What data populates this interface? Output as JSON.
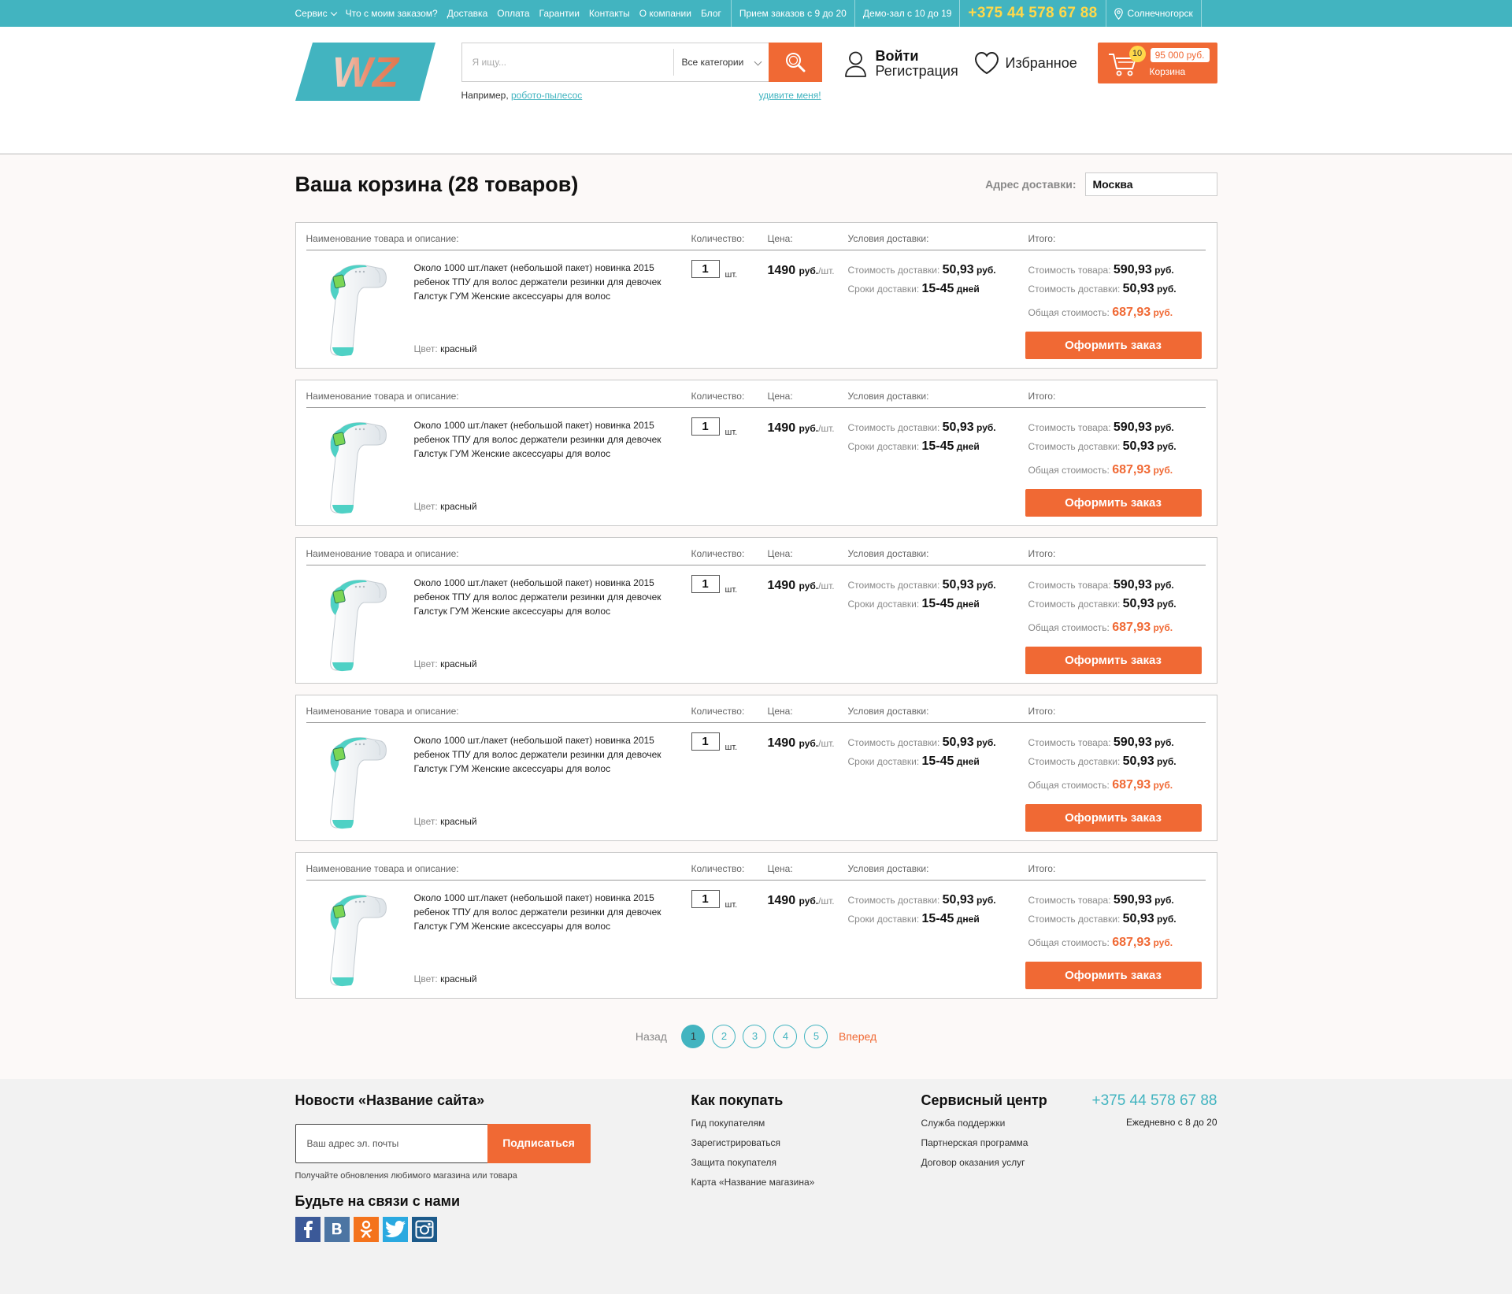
{
  "topbar": {
    "nav": [
      "Сервис",
      "Что с моим заказом?",
      "Доставка",
      "Оплата",
      "Гарантии",
      "Контакты",
      "О компании",
      "Блог"
    ],
    "orders_hours": "Прием заказов с 9 до 20",
    "demo_hours": "Демо-зал с 10 до 19",
    "phone": "+375 44 578 67 88",
    "city": "Солнечногорск"
  },
  "header": {
    "logo_text": "WZ",
    "search_placeholder": "Я ищу...",
    "category": "Все категории",
    "hint_prefix": "Например,",
    "hint_link": "робото-пылесос",
    "surprise": "удивите меня!",
    "login": "Войти",
    "register": "Регистрация",
    "favorites": "Избранное",
    "cart_count": "10",
    "cart_sum": "95 000 руб.",
    "cart_label": "Корзина"
  },
  "page": {
    "title": "Ваша корзина (28 товаров)",
    "address_label": "Адрес доставки:",
    "address_value": "Москва"
  },
  "columns": {
    "name": "Наименование товара и описание:",
    "qty": "Количество:",
    "price": "Цена:",
    "delivery": "Условия доставки:",
    "total": "Итого:"
  },
  "cart_items": [
    {
      "desc": "Около 1000 шт./пакет (небольшой пакет) новинка 2015 ребенок ТПУ для волос держатели резинки для девочек Галстук ГУМ Женские аксессуары для волос",
      "color_label": "Цвет:",
      "color": "красный",
      "qty": "1",
      "unit": "шт.",
      "price": "1490",
      "price_cur": "руб.",
      "price_per": "/шт.",
      "delivery_cost_label": "Стоимость доставки:",
      "delivery_cost": "50,93",
      "delivery_time_label": "Сроки доставки:",
      "delivery_time": "15-45",
      "delivery_time_unit": "дней",
      "goods_cost_label": "Стоимость товара:",
      "goods_cost": "590,93",
      "ship_cost_label": "Стоимость доставки:",
      "ship_cost": "50,93",
      "total_label": "Общая стоимость:",
      "total": "687,93",
      "cur": "руб.",
      "order_btn": "Оформить заказ"
    },
    {
      "desc": "Около 1000 шт./пакет (небольшой пакет) новинка 2015 ребенок ТПУ для волос держатели резинки для девочек Галстук ГУМ Женские аксессуары для волос",
      "color_label": "Цвет:",
      "color": "красный",
      "qty": "1",
      "unit": "шт.",
      "price": "1490",
      "price_cur": "руб.",
      "price_per": "/шт.",
      "delivery_cost_label": "Стоимость доставки:",
      "delivery_cost": "50,93",
      "delivery_time_label": "Сроки доставки:",
      "delivery_time": "15-45",
      "delivery_time_unit": "дней",
      "goods_cost_label": "Стоимость товара:",
      "goods_cost": "590,93",
      "ship_cost_label": "Стоимость доставки:",
      "ship_cost": "50,93",
      "total_label": "Общая стоимость:",
      "total": "687,93",
      "cur": "руб.",
      "order_btn": "Оформить заказ"
    },
    {
      "desc": "Около 1000 шт./пакет (небольшой пакет) новинка 2015 ребенок ТПУ для волос держатели резинки для девочек Галстук ГУМ Женские аксессуары для волос",
      "color_label": "Цвет:",
      "color": "красный",
      "qty": "1",
      "unit": "шт.",
      "price": "1490",
      "price_cur": "руб.",
      "price_per": "/шт.",
      "delivery_cost_label": "Стоимость доставки:",
      "delivery_cost": "50,93",
      "delivery_time_label": "Сроки доставки:",
      "delivery_time": "15-45",
      "delivery_time_unit": "дней",
      "goods_cost_label": "Стоимость товара:",
      "goods_cost": "590,93",
      "ship_cost_label": "Стоимость доставки:",
      "ship_cost": "50,93",
      "total_label": "Общая стоимость:",
      "total": "687,93",
      "cur": "руб.",
      "order_btn": "Оформить заказ"
    },
    {
      "desc": "Около 1000 шт./пакет (небольшой пакет) новинка 2015 ребенок ТПУ для волос держатели резинки для девочек Галстук ГУМ Женские аксессуары для волос",
      "color_label": "Цвет:",
      "color": "красный",
      "qty": "1",
      "unit": "шт.",
      "price": "1490",
      "price_cur": "руб.",
      "price_per": "/шт.",
      "delivery_cost_label": "Стоимость доставки:",
      "delivery_cost": "50,93",
      "delivery_time_label": "Сроки доставки:",
      "delivery_time": "15-45",
      "delivery_time_unit": "дней",
      "goods_cost_label": "Стоимость товара:",
      "goods_cost": "590,93",
      "ship_cost_label": "Стоимость доставки:",
      "ship_cost": "50,93",
      "total_label": "Общая стоимость:",
      "total": "687,93",
      "cur": "руб.",
      "order_btn": "Оформить заказ"
    },
    {
      "desc": "Около 1000 шт./пакет (небольшой пакет) новинка 2015 ребенок ТПУ для волос держатели резинки для девочек Галстук ГУМ Женские аксессуары для волос",
      "color_label": "Цвет:",
      "color": "красный",
      "qty": "1",
      "unit": "шт.",
      "price": "1490",
      "price_cur": "руб.",
      "price_per": "/шт.",
      "delivery_cost_label": "Стоимость доставки:",
      "delivery_cost": "50,93",
      "delivery_time_label": "Сроки доставки:",
      "delivery_time": "15-45",
      "delivery_time_unit": "дней",
      "goods_cost_label": "Стоимость товара:",
      "goods_cost": "590,93",
      "ship_cost_label": "Стоимость доставки:",
      "ship_cost": "50,93",
      "total_label": "Общая стоимость:",
      "total": "687,93",
      "cur": "руб.",
      "order_btn": "Оформить заказ"
    }
  ],
  "pager": {
    "prev": "Назад",
    "pages": [
      "1",
      "2",
      "3",
      "4",
      "5"
    ],
    "active": "1",
    "next": "Вперед"
  },
  "footer": {
    "news_title": "Новости «Название сайта»",
    "email_placeholder": "Ваш адрес эл. почты",
    "subscribe": "Подписаться",
    "subscribe_note": "Получайте обновления любимого магазина или товара",
    "social_title": "Будьте на связи с нами",
    "social": [
      {
        "icon": "facebook-icon",
        "glyph": "f",
        "color": "#3b5998"
      },
      {
        "icon": "vk-icon",
        "glyph": "B",
        "color": "#4c75a3"
      },
      {
        "icon": "odnoklassniki-icon",
        "glyph": "ok",
        "color": "#f4731c"
      },
      {
        "icon": "twitter-icon",
        "glyph": "t",
        "color": "#2aa9e0"
      },
      {
        "icon": "instagram-icon",
        "glyph": "ig",
        "color": "#1c5a8a"
      }
    ],
    "how_title": "Как покупать",
    "how_links": [
      "Гид покупателям",
      "Зарегистрироваться",
      "Защита покупателя",
      "Карта «Название магазина»"
    ],
    "service_title": "Сервисный центр",
    "service_links": [
      "Служба поддержки",
      "Партнерская программа",
      "Договор оказания услуг"
    ],
    "phone": "+375 44 578 67 88",
    "hours": "Ежедневно с 8 до 20"
  },
  "colors": {
    "accent": "#42b4c0",
    "orange": "#f06934",
    "yellow": "#ffd84a"
  }
}
